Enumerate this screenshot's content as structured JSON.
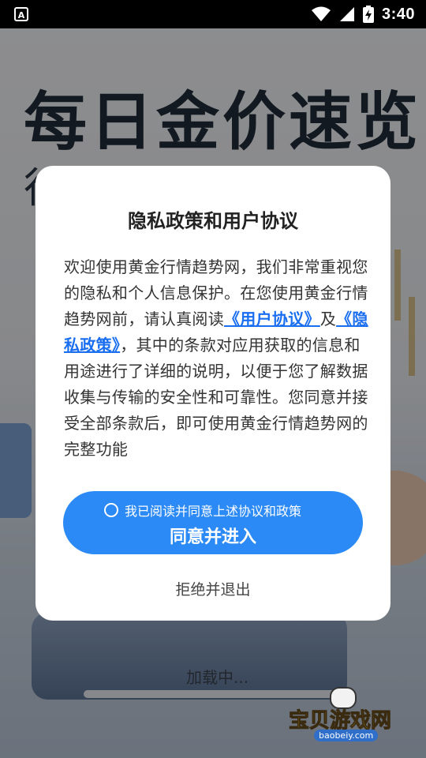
{
  "status_bar": {
    "time": "3:40",
    "notification_icon": "a-icon",
    "wifi_icon": "wifi-icon",
    "signal_icon": "signal-icon",
    "battery_icon": "battery-charging-icon"
  },
  "background": {
    "title": "每日金价速览",
    "subtitle": "行情尽在掌中",
    "loading_text": "加载中..."
  },
  "dialog": {
    "title": "隐私政策和用户协议",
    "body_part1": "欢迎使用黄金行情趋势网，我们非常重视您的隐私和个人信息保护。在您使用黄金行情趋势网前，请认真阅读",
    "user_agreement_link": "《用户协议》",
    "body_and": "及",
    "privacy_policy_link": "《隐私政策》",
    "body_part2": "，其中的条款对应用获取的信息和用途进行了详细的说明，以便于您了解数据收集与传输的安全性和可靠性。您同意并接受全部条款后，即可使用黄金行情趋势网的完整功能",
    "agree_note": "我已阅读并同意上述协议和政策",
    "agree_button": "同意并进入",
    "reject_button": "拒绝并退出"
  },
  "watermark": {
    "text": "宝贝游戏网",
    "url": "baobeiy.com"
  }
}
